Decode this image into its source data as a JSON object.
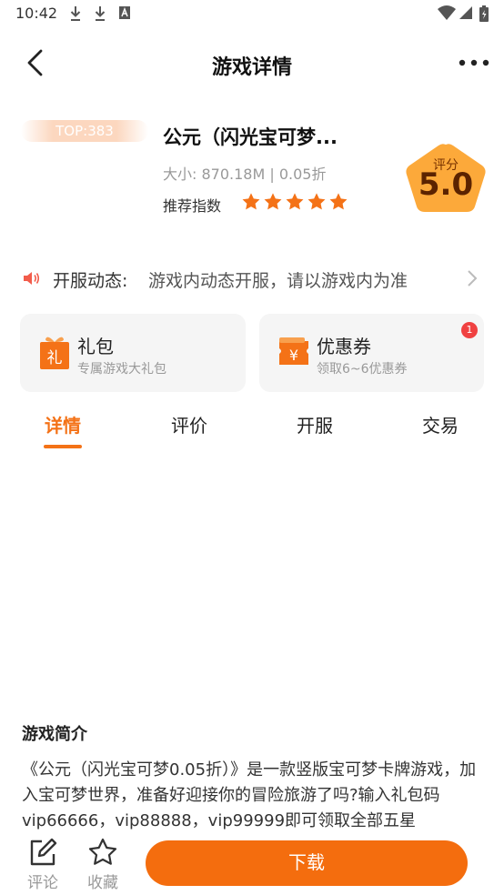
{
  "status_bar": {
    "time": "10:42"
  },
  "nav": {
    "title": "游戏详情"
  },
  "game": {
    "top_rank": "TOP:383",
    "name": "公元（闪光宝可梦...",
    "meta": "大小: 870.18M | 0.05折",
    "recommend_label": "推荐指数",
    "stars": 5,
    "score_label": "评分",
    "score_value": "5.0"
  },
  "notice": {
    "label": "开服动态:",
    "text": "游戏内动态开服，请以游戏内为准"
  },
  "cards": [
    {
      "title": "礼包",
      "subtitle": "专属游戏大礼包",
      "icon": "gift-icon",
      "icon_char": "礼"
    },
    {
      "title": "优惠券",
      "subtitle": "领取6~6优惠券",
      "icon": "coupon-icon",
      "icon_char": "¥",
      "badge": "1"
    }
  ],
  "tabs": [
    {
      "label": "详情",
      "active": true
    },
    {
      "label": "评价",
      "active": false
    },
    {
      "label": "开服",
      "active": false
    },
    {
      "label": "交易",
      "active": false
    }
  ],
  "intro": {
    "title": "游戏简介",
    "text": "《公元（闪光宝可梦0.05折）》是一款竖版宝可梦卡牌游戏，加入宝可梦世界，准备好迎接你的冒险旅游了吗?输入礼包码vip66666，vip88888，vip99999即可领取全部五星"
  },
  "bottom_bar": {
    "comment_label": "评论",
    "favorite_label": "收藏",
    "download_label": "下载"
  },
  "colors": {
    "accent": "#f47217",
    "score_badge": "#fca93a",
    "badge_red": "#f04141"
  }
}
